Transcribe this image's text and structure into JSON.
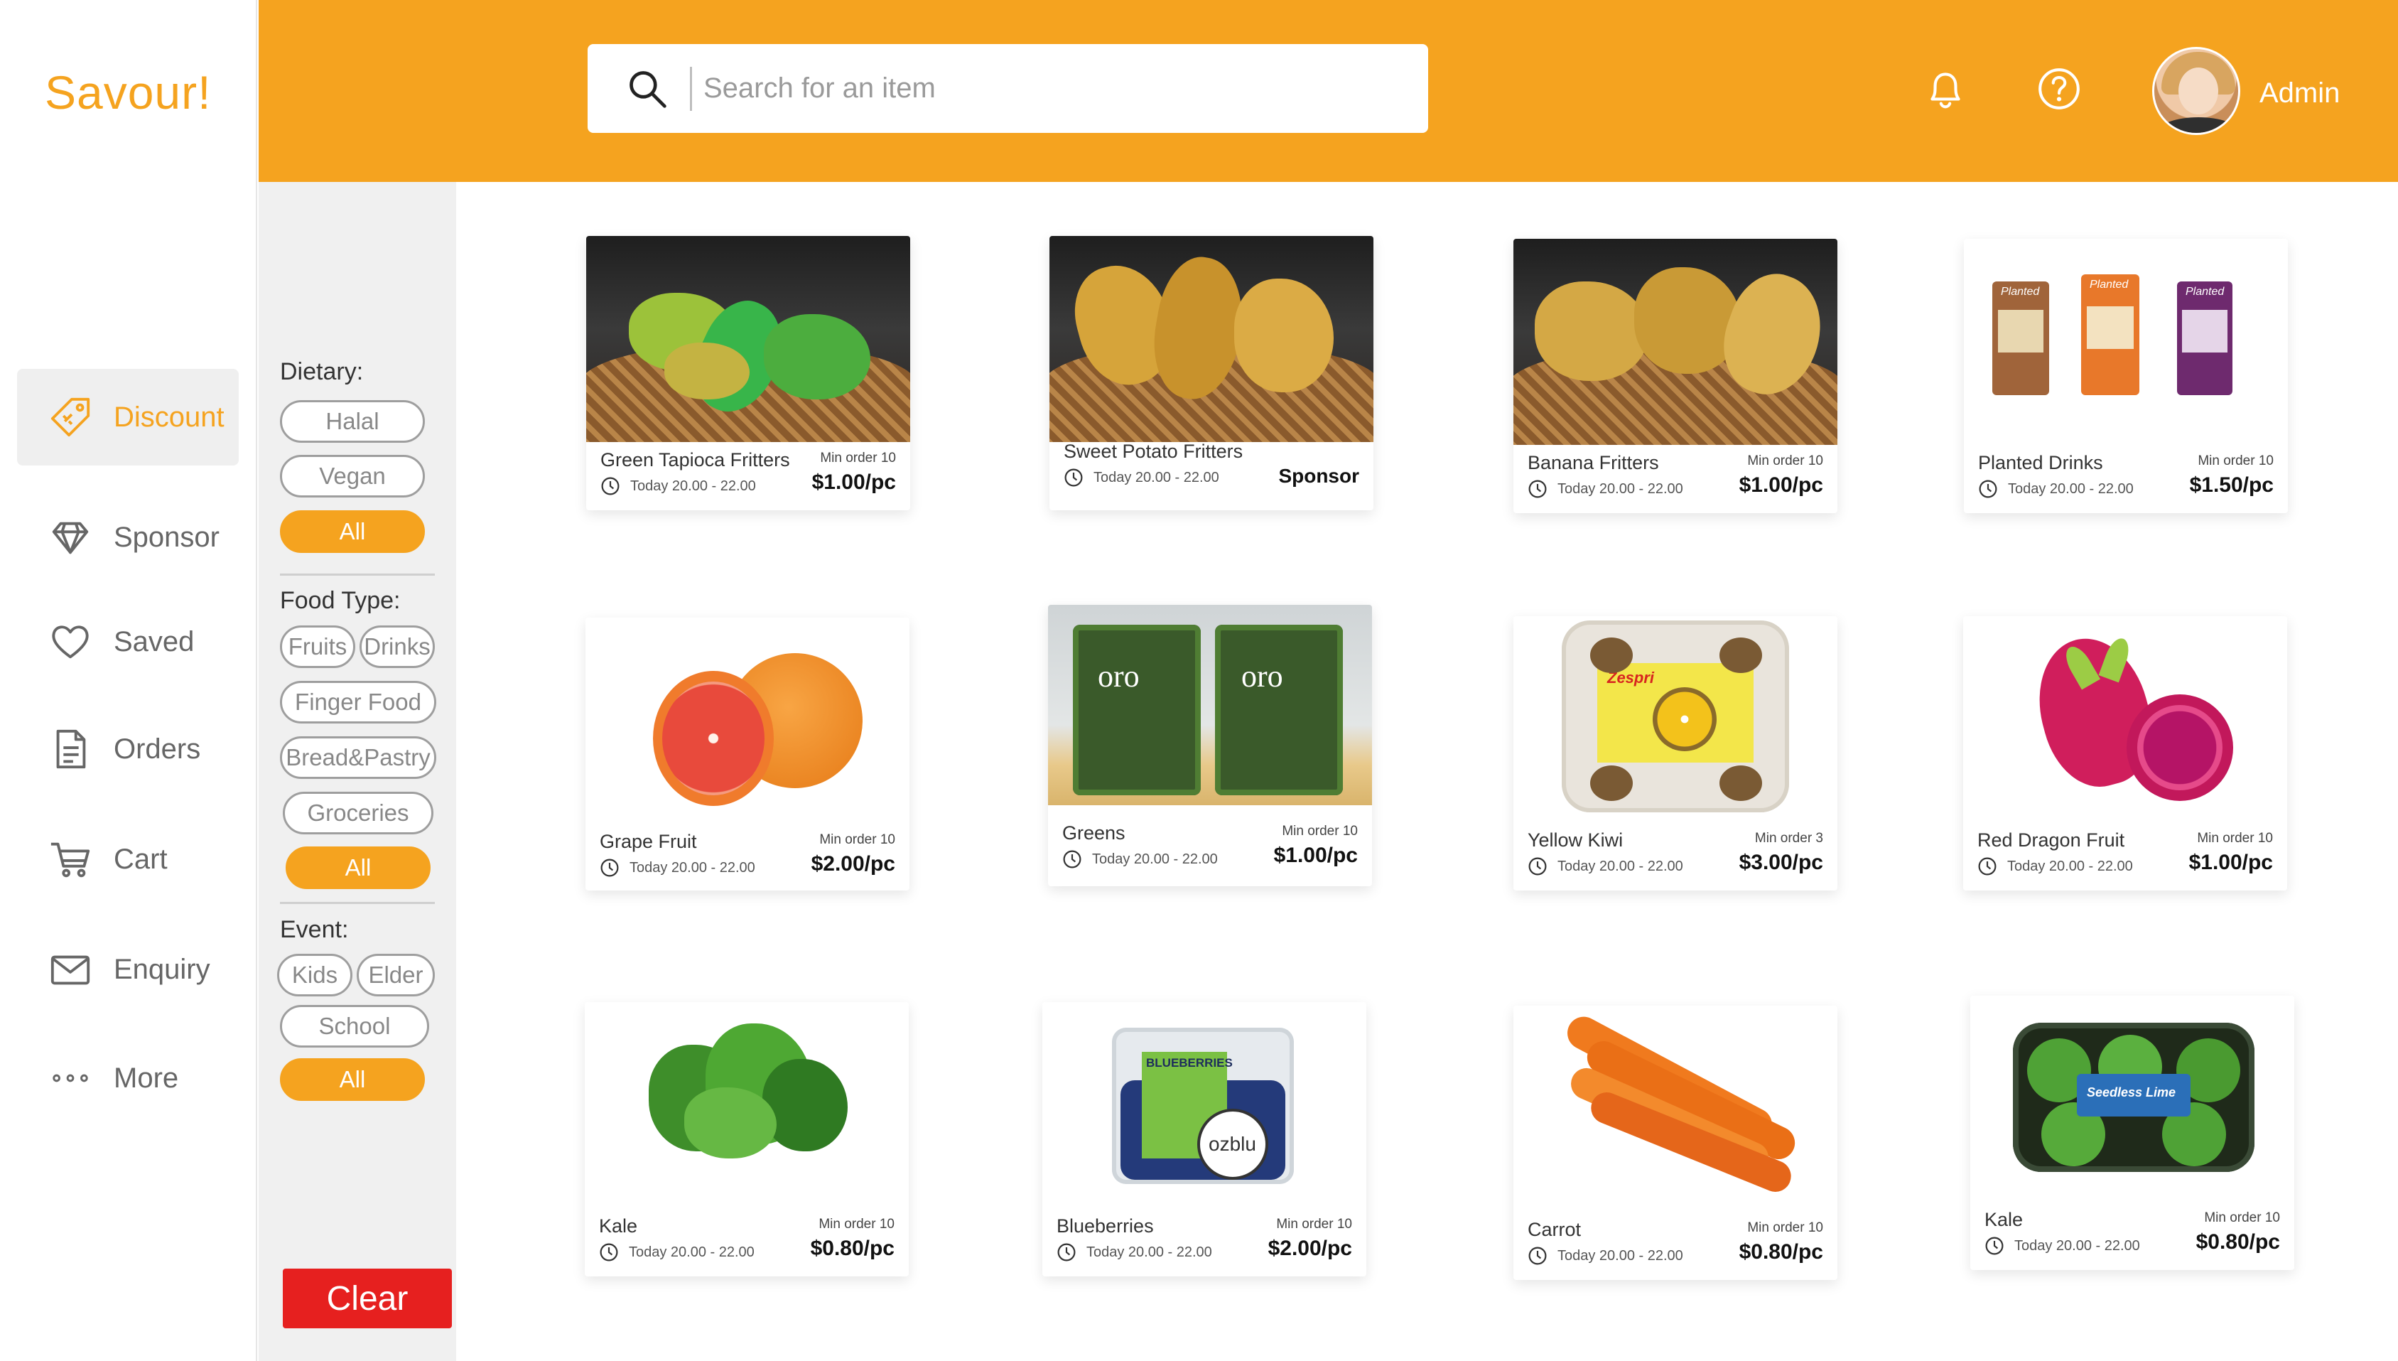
{
  "app": {
    "name": "Savour!"
  },
  "nav": {
    "items": [
      {
        "label": "Discount",
        "icon": "tag-icon",
        "active": true
      },
      {
        "label": "Sponsor",
        "icon": "diamond-icon",
        "active": false
      },
      {
        "label": "Saved",
        "icon": "heart-icon",
        "active": false
      },
      {
        "label": "Orders",
        "icon": "document-icon",
        "active": false
      },
      {
        "label": "Cart",
        "icon": "cart-icon",
        "active": false
      },
      {
        "label": "Enquiry",
        "icon": "mail-icon",
        "active": false
      },
      {
        "label": "More",
        "icon": "more-icon",
        "active": false
      }
    ]
  },
  "header": {
    "search_placeholder": "Search for an item",
    "user_name": "Admin",
    "accent_color": "#f5a31f"
  },
  "filters": {
    "dietary": {
      "title": "Dietary:",
      "options": [
        "Halal",
        "Vegan"
      ],
      "all": "All"
    },
    "food_type": {
      "title": "Food Type:",
      "options": [
        "Fruits",
        "Drinks",
        "Finger Food",
        "Bread&Pastry",
        "Groceries"
      ],
      "all": "All"
    },
    "event": {
      "title": "Event:",
      "options": [
        "Kids",
        "Elder",
        "School"
      ],
      "all": "All"
    },
    "clear_label": "Clear"
  },
  "products": [
    {
      "name": "Green Tapioca Fritters",
      "time": "Today 20.00 - 22.00",
      "min_order": "Min order 10",
      "price": "$1.00/pc"
    },
    {
      "name": "Sweet Potato Fritters",
      "time": "Today 20.00 - 22.00",
      "min_order": "",
      "price": "Sponsor"
    },
    {
      "name": "Banana Fritters",
      "time": "Today 20.00 - 22.00",
      "min_order": "Min order 10",
      "price": "$1.00/pc"
    },
    {
      "name": "Planted Drinks",
      "time": "Today 20.00 - 22.00",
      "min_order": "Min order 10",
      "price": "$1.50/pc"
    },
    {
      "name": "Grape Fruit",
      "time": "Today 20.00 - 22.00",
      "min_order": "Min order 10",
      "price": "$2.00/pc"
    },
    {
      "name": "Greens",
      "time": "Today 20.00 - 22.00",
      "min_order": "Min order 10",
      "price": "$1.00/pc"
    },
    {
      "name": "Yellow Kiwi",
      "time": "Today 20.00 - 22.00",
      "min_order": "Min order 3",
      "price": "$3.00/pc"
    },
    {
      "name": "Red Dragon Fruit",
      "time": "Today 20.00 - 22.00",
      "min_order": "Min order 10",
      "price": "$1.00/pc"
    },
    {
      "name": "Kale",
      "time": "Today 20.00 - 22.00",
      "min_order": "Min order 10",
      "price": "$0.80/pc"
    },
    {
      "name": "Blueberries",
      "time": "Today 20.00 - 22.00",
      "min_order": "Min order 10",
      "price": "$2.00/pc"
    },
    {
      "name": "Carrot",
      "time": "Today 20.00 - 22.00",
      "min_order": "Min order 10",
      "price": "$0.80/pc"
    },
    {
      "name": "Kale",
      "time": "Today 20.00 - 22.00",
      "min_order": "Min order 10",
      "price": "$0.80/pc"
    }
  ],
  "image_labels": {
    "greens_brand": "oro",
    "blueberries_pack": "BLUEBERRIES",
    "blueberries_brand": "ozblu",
    "drinks_brand": "Planted",
    "kiwi_brand": "Zespri",
    "lime_label": "Seedless Lime"
  }
}
